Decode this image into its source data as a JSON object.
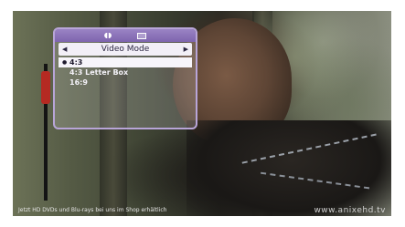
{
  "osd": {
    "icons": [
      "audio-icon",
      "subtitle-box-icon"
    ],
    "title": "Video Mode",
    "prev_arrow": "◀",
    "next_arrow": "▶",
    "options": [
      {
        "label": "4:3",
        "selected": true
      },
      {
        "label": "4:3 Letter Box",
        "selected": false
      },
      {
        "label": "16:9",
        "selected": false
      }
    ]
  },
  "ticker": {
    "text": "Jetzt HD DVDs und Blu-rays bei uns im Shop erhältlich",
    "url": "www.anixehd.tv"
  },
  "colors": {
    "osd_header": "#8a72b8",
    "osd_border": "#b8a5d8",
    "selected_bg": "#f7f5fb"
  }
}
